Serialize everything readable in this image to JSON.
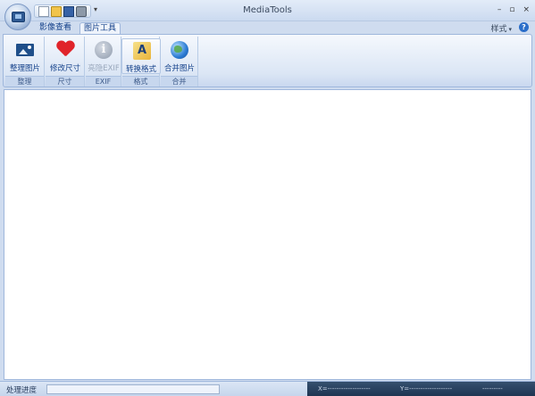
{
  "window": {
    "title": "MediaTools",
    "controls": {
      "minimize": "–",
      "maximize": "▫",
      "close": "×"
    }
  },
  "quick_access": {
    "icons": [
      "new-document-icon",
      "open-folder-icon",
      "save-icon",
      "print-icon"
    ],
    "more": "▾"
  },
  "tabs": [
    {
      "label": "影像查看",
      "active": false
    },
    {
      "label": "图片工具",
      "active": true
    }
  ],
  "style_menu": {
    "label": "样式",
    "arrow": "▾"
  },
  "help": "?",
  "ribbon": {
    "groups": [
      {
        "label": "整理",
        "buttons": [
          {
            "label": "整理图片",
            "icon": "picture-icon",
            "enabled": true
          }
        ]
      },
      {
        "label": "尺寸",
        "buttons": [
          {
            "label": "修改尺寸",
            "icon": "heart-icon",
            "enabled": true
          }
        ]
      },
      {
        "label": "EXIF",
        "buttons": [
          {
            "label": "亮隐EXIF",
            "icon": "info-icon",
            "glyph": "i",
            "enabled": false
          }
        ]
      },
      {
        "label": "格式",
        "buttons": [
          {
            "label": "转换格式",
            "icon": "convert-format-icon",
            "glyph": "A",
            "enabled": true
          }
        ]
      },
      {
        "label": "合并",
        "buttons": [
          {
            "label": "合并图片",
            "icon": "globe-icon",
            "enabled": true
          }
        ]
      }
    ]
  },
  "statusbar": {
    "progress_label": "处理进度",
    "progress_value": 0,
    "x_readout": "X=-------------------",
    "y_readout": "Y=-------------------",
    "extra_readout": "---------"
  },
  "colors": {
    "accent": "#15428b",
    "ribbon_bg": "#dbe6f5",
    "frame_bg": "#cfdcef",
    "status_dark": "#1d3350"
  }
}
